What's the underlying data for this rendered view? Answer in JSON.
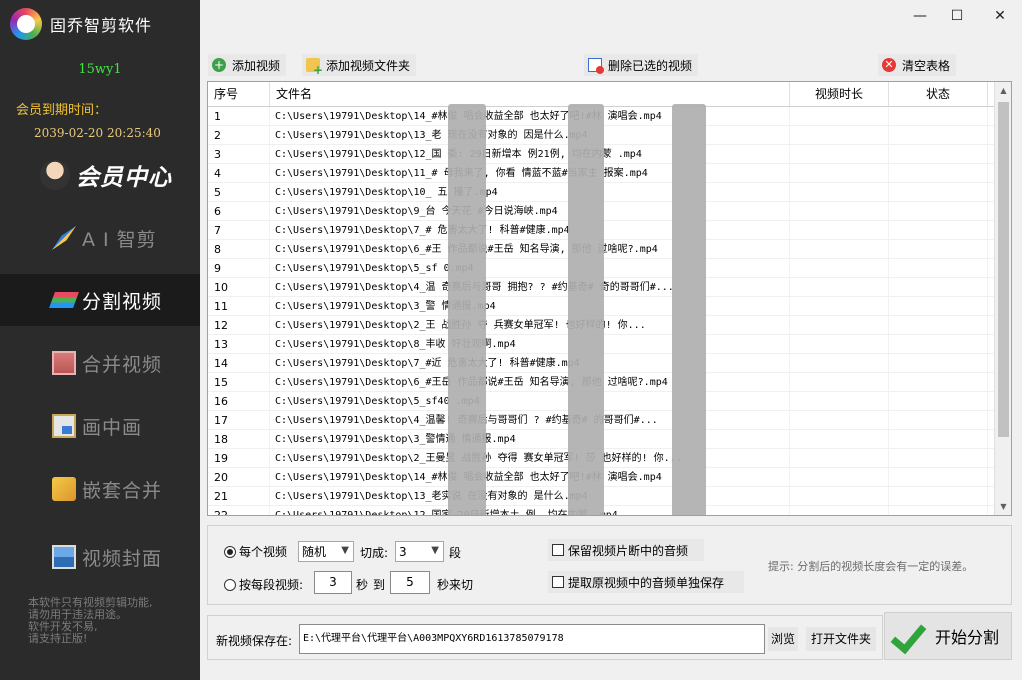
{
  "app": {
    "title": "固乔智剪软件"
  },
  "user": {
    "name": "15wy1",
    "expire_label": "会员到期时间：",
    "expire_date": "2039-02-20 20:25:40"
  },
  "vip": {
    "label": "会员中心"
  },
  "nav": [
    {
      "label": "A I 智剪",
      "icon": "ai-magic-icon",
      "active": false
    },
    {
      "label": "分割视频",
      "icon": "split-video-icon",
      "active": true
    },
    {
      "label": "合并视频",
      "icon": "merge-video-icon",
      "active": false
    },
    {
      "label": "画中画",
      "icon": "picture-in-picture-icon",
      "active": false
    },
    {
      "label": "嵌套合并",
      "icon": "nest-merge-icon",
      "active": false
    },
    {
      "label": "视频封面",
      "icon": "video-cover-icon",
      "active": false
    }
  ],
  "notice": {
    "lines": [
      "本软件只有视频剪辑功能,",
      "请勿用于违法用途。",
      "软件开发不易,",
      "请支持正版!"
    ]
  },
  "window": {
    "minimize": "—",
    "maximize": "☐",
    "close": "✕"
  },
  "toolbar": {
    "add_video": "添加视频",
    "add_folder": "添加视频文件夹",
    "delete_selected": "删除已选的视频",
    "clear_table": "清空表格"
  },
  "table": {
    "columns": [
      "序号",
      "文件名",
      "视频时长",
      "状态"
    ],
    "rows": [
      {
        "no": "1",
        "name": "C:\\Users\\19791\\Desktop\\14_#林俊  唱会收益全部  也太好了吧!#林  演唱会.mp4"
      },
      {
        "no": "2",
        "name": "C:\\Users\\19791\\Desktop\\13_老  现在没有对象的  因是什么.mp4"
      },
      {
        "no": "3",
        "name": "C:\\Users\\19791\\Desktop\\12_国  委: 29日新增本  例21例, 均在内蒙  .mp4"
      },
      {
        "no": "4",
        "name": "C:\\Users\\19791\\Desktop\\11_#  母我来了, 你看  情蓝不蓝#当家主  报案.mp4"
      },
      {
        "no": "5",
        "name": "C:\\Users\\19791\\Desktop\\10_  五  撞了.mp4"
      },
      {
        "no": "6",
        "name": "C:\\Users\\19791\\Desktop\\9_台  今天花  #今日说海峡.mp4"
      },
      {
        "no": "7",
        "name": "C:\\Users\\19791\\Desktop\\7_#  危害太大了!  科普#健康.mp4"
      },
      {
        "no": "8",
        "name": "C:\\Users\\19791\\Desktop\\6_#王  作品都说#王岳  知名导演, 那他  过啥呢?.mp4"
      },
      {
        "no": "9",
        "name": "C:\\Users\\19791\\Desktop\\5_sf  0.mp4"
      },
      {
        "no": "10",
        "name": "C:\\Users\\19791\\Desktop\\4_温  奇赛后与哥哥  拥抱? ? #约基奇#  奇的哥哥们#..."
      },
      {
        "no": "11",
        "name": "C:\\Users\\19791\\Desktop\\3_警  情通报.mp4"
      },
      {
        "no": "12",
        "name": "C:\\Users\\19791\\Desktop\\2_王  战胜孙  夺  兵赛女单冠军!  也好样的! 你..."
      },
      {
        "no": "13",
        "name": "C:\\Users\\19791\\Desktop\\8_丰收  好壮观啊.mp4"
      },
      {
        "no": "14",
        "name": "C:\\Users\\19791\\Desktop\\7_#近  危害太大了!  科普#健康.mp4"
      },
      {
        "no": "15",
        "name": "C:\\Users\\19791\\Desktop\\6_#王岳  作品都说#王岳  知名导演, 那他  过啥呢?.mp4"
      },
      {
        "no": "16",
        "name": "C:\\Users\\19791\\Desktop\\5_sf40  .mp4"
      },
      {
        "no": "17",
        "name": "C:\\Users\\19791\\Desktop\\4_温馨!  奇赛后与哥哥们  ? #约基奇#  的哥哥们#..."
      },
      {
        "no": "18",
        "name": "C:\\Users\\19791\\Desktop\\3_警情通  情通报.mp4"
      },
      {
        "no": "19",
        "name": "C:\\Users\\19791\\Desktop\\2_王曼昱  战胜孙  夺得  赛女单冠军! 莎  也好样的! 你..."
      },
      {
        "no": "20",
        "name": "C:\\Users\\19791\\Desktop\\14_#林俊  唱会收益全部  也太好了吧!#林  演唱会.mp4"
      },
      {
        "no": "21",
        "name": "C:\\Users\\19791\\Desktop\\13_老实说  在没有对象的  是什么.mp4"
      },
      {
        "no": "22",
        "name": "C:\\Users\\19791\\Desktop\\12_国家  29日新增本土  例, 均在内蒙  .mp4"
      }
    ]
  },
  "options": {
    "mode_each": "每个视频",
    "mode_each_selected": true,
    "random_select": "随机",
    "cut_label": "切成:",
    "cut_count": "3",
    "cut_unit": "段",
    "mode_per_segment": "按每段视频:",
    "seconds_from": "3",
    "seconds_label": "秒",
    "to_label": "到",
    "seconds_to": "5",
    "seconds_cut_label": "秒来切",
    "keep_audio": "保留视频片断中的音频",
    "extract_audio": "提取原视频中的音频单独保存",
    "hint": "提示: 分割后的视频长度会有一定的误差。"
  },
  "save": {
    "label": "新视频保存在:",
    "path": "E:\\代理平台\\代理平台\\A003MPQXY6RD1613785079178",
    "browse": "浏览",
    "open_folder": "打开文件夹",
    "start": "开始分割"
  }
}
